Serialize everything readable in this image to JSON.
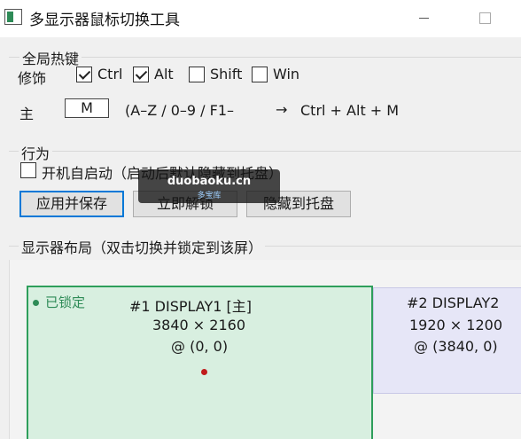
{
  "window": {
    "title": "多显示器鼠标切换工具",
    "icon": "app-window-icon"
  },
  "hotkey": {
    "group_title": "全局热键",
    "modifiers_label": "修饰",
    "modifiers": [
      {
        "label": "Ctrl",
        "checked": true
      },
      {
        "label": "Alt",
        "checked": true
      },
      {
        "label": "Shift",
        "checked": false
      },
      {
        "label": "Win",
        "checked": false
      }
    ],
    "main_label": "主",
    "main_key": "M",
    "hint": "(A–Z / 0–9 / F1–",
    "arrow": "→",
    "combo": "Ctrl + Alt + M"
  },
  "behavior": {
    "group_title": "行为",
    "autostart_label": "开机自启动（启动后默认隐藏到托盘）",
    "autostart_checked": false,
    "buttons": {
      "apply": "应用并保存",
      "unlock": "立即解锁",
      "hide": "隐藏到托盘"
    }
  },
  "watermark": {
    "main": "duobaoku.cn",
    "sub": "多宝库"
  },
  "layout": {
    "group_title": "显示器布局（双击切换并锁定到该屏）",
    "monitors": [
      {
        "title": "#1  DISPLAY1  [主]",
        "resolution": "3840 × 2160",
        "origin": "@ (0, 0)",
        "locked_label": "已锁定",
        "locked": true,
        "color": "#2e9e5b"
      },
      {
        "title": "#2  DISPLAY2",
        "resolution": "1920 × 1200",
        "origin": "@ (3840, 0)",
        "locked": false
      }
    ]
  },
  "colors": {
    "locked_accent": "#2e8b57",
    "primary_button_border": "#0078d7",
    "cursor_marker": "#c01b1b"
  }
}
